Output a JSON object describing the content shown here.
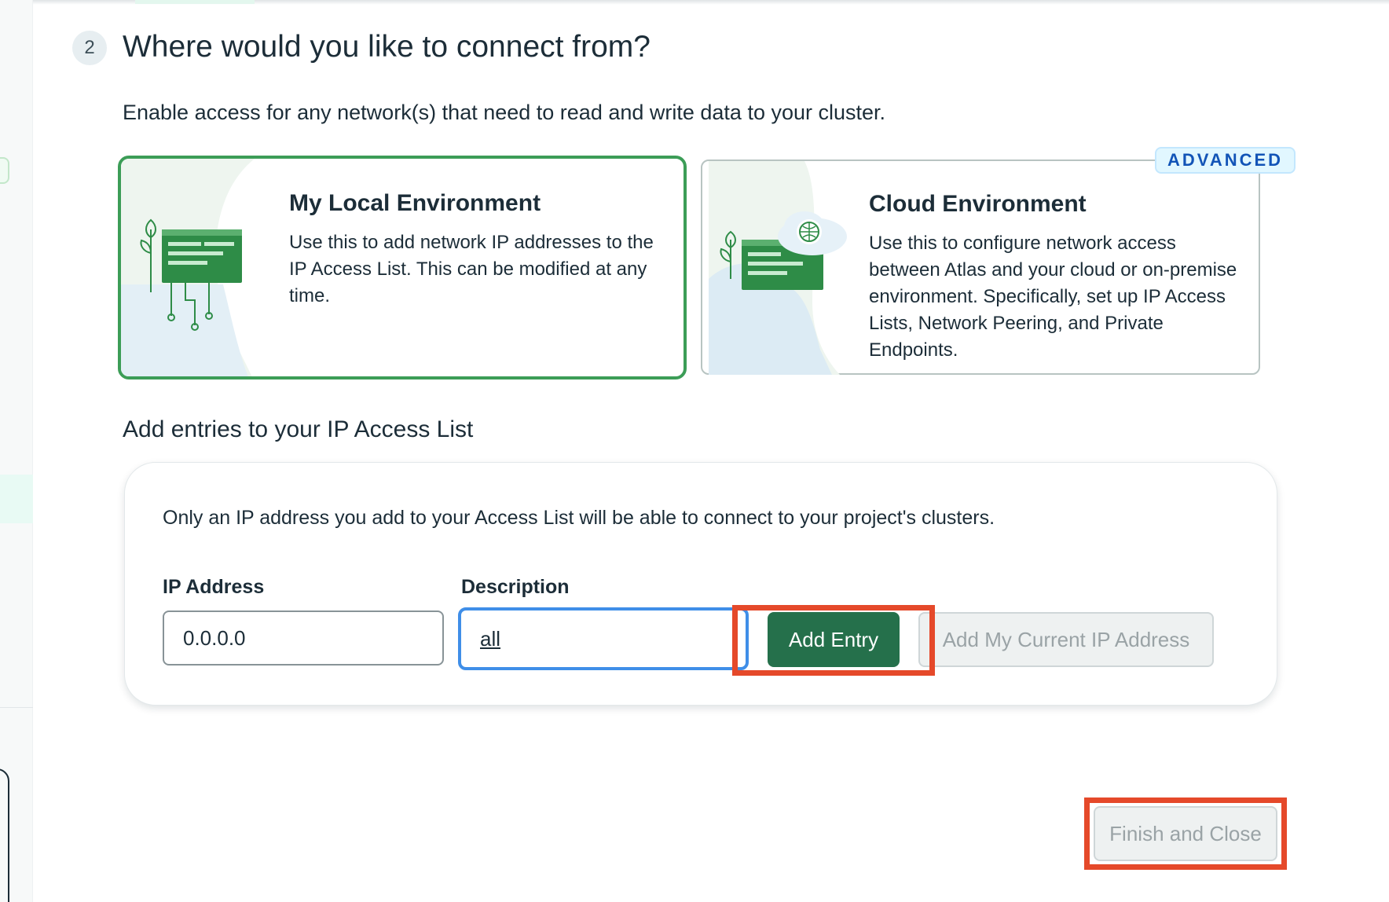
{
  "step": {
    "number": "2",
    "title": "Where would you like to connect from?",
    "subtitle": "Enable access for any network(s) that need to read and write data to your cluster."
  },
  "environments": [
    {
      "title": "My Local Environment",
      "description": "Use this to add network IP addresses to the IP Access List. This can be modified at any time.",
      "selected": true
    },
    {
      "title": "Cloud Environment",
      "description": "Use this to configure network access between Atlas and your cloud or on-premise environment. Specifically, set up IP Access Lists, Network Peering, and Private Endpoints.",
      "badge": "ADVANCED",
      "selected": false
    }
  ],
  "ip_access": {
    "section_title": "Add entries to your IP Access List",
    "note": "Only an IP address you add to your Access List will be able to connect to your project's clusters.",
    "ip_label": "IP Address",
    "ip_value": "0.0.0.0",
    "description_label": "Description",
    "description_value": "all",
    "add_entry_label": "Add Entry",
    "add_current_ip_label": "Add My Current IP Address"
  },
  "footer": {
    "finish_label": "Finish and Close"
  },
  "colors": {
    "selected_border": "#3c9d57",
    "primary_button": "#25704b",
    "focus_ring": "#3f8ee8",
    "highlight": "#e5492a",
    "badge_text": "#1254b7"
  }
}
